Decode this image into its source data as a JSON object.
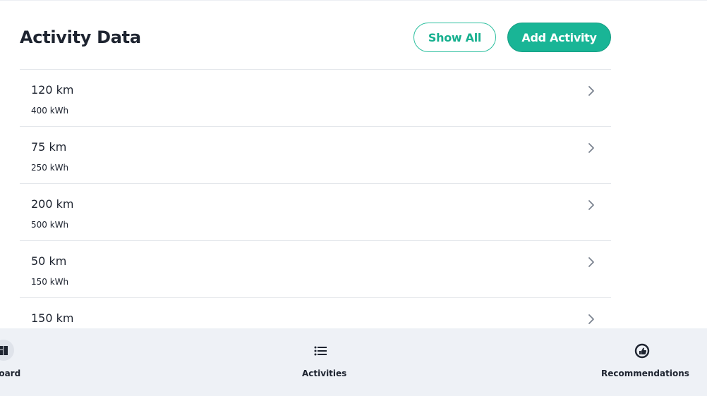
{
  "header": {
    "title": "Activity Data",
    "show_all_label": "Show All",
    "add_activity_label": "Add Activity"
  },
  "activities": [
    {
      "distance": "120 km",
      "energy": "400 kWh"
    },
    {
      "distance": "75 km",
      "energy": "250 kWh"
    },
    {
      "distance": "200 km",
      "energy": "500 kWh"
    },
    {
      "distance": "50 km",
      "energy": "150 kWh"
    },
    {
      "distance": "150 km",
      "energy": ""
    }
  ],
  "tabbar": {
    "dashboard_label": "Dashboard",
    "activities_label": "Activities",
    "recommendations_label": "Recommendations"
  },
  "colors": {
    "accent": "#19b596",
    "tabbar_bg": "#eef1f6",
    "divider": "#e4e7eb"
  }
}
